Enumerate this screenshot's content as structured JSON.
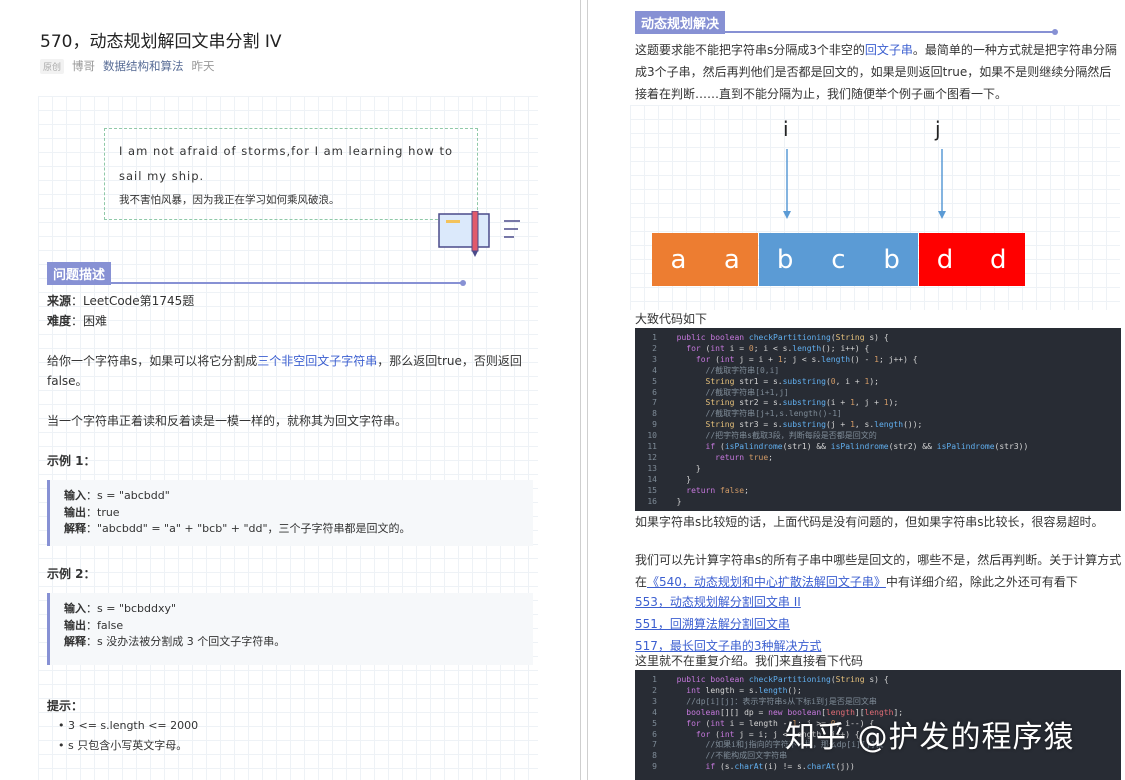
{
  "article": {
    "title": "570，动态规划解回文串分割 IV",
    "badge": "原创",
    "author": "博哥",
    "column": "数据结构和算法",
    "date": "昨天"
  },
  "quote": {
    "en": "I am not afraid of storms,for I am learning how to sail my ship.",
    "cn": "我不害怕风暴，因为我正在学习如何乘风破浪。"
  },
  "problem": {
    "section_title": "问题描述",
    "source_label": "来源",
    "source_value": "：LeetCode第1745题",
    "difficulty_label": "难度",
    "difficulty_value": "：困难",
    "desc_a": "给你一个字符串s，如果可以将它分割成",
    "desc_hl": "三个非空回文子字符串",
    "desc_b": "，那么返回true，否则返回false。",
    "desc2": "当一个字符串正着读和反着读是一模一样的，就称其为回文字符串。",
    "example1_title": "示例 1：",
    "example1": {
      "input_label": "输入",
      "input": "：s = \"abcbdd\"",
      "output_label": "输出",
      "output": "：true",
      "explain_label": "解释",
      "explain": "：\"abcbdd\" = \"a\" + \"bcb\" + \"dd\"，三个子字符串都是回文的。"
    },
    "example2_title": "示例 2：",
    "example2": {
      "input_label": "输入",
      "input": "：s = \"bcbddxy\"",
      "output_label": "输出",
      "output": "：false",
      "explain_label": "解释",
      "explain": "：s 没办法被分割成 3 个回文子字符串。"
    },
    "hint_title": "提示：",
    "hints": [
      "3 <= s.length <= 2000",
      "s 只包含小写英文字母。"
    ]
  },
  "solution": {
    "section_title": "动态规划解决",
    "p1_a": "这题要求能不能把字符串s分隔成3个非空的",
    "p1_hl": "回文子串",
    "p1_b": "。最简单的一种方式就是把字符串分隔成3个子串，然后再判他们是否都是回文的，如果是则返回true，如果不是则继续分隔然后接着在判断……直到不能分隔为止，我们随便举个例子画个图看一下。",
    "diagram": {
      "pointer_i": "i",
      "pointer_j": "j",
      "cells": [
        {
          "ch": "a",
          "color": "#ed7d31"
        },
        {
          "ch": "a",
          "color": "#ed7d31"
        },
        {
          "ch": "b",
          "color": "#5b9bd5"
        },
        {
          "ch": "c",
          "color": "#5b9bd5"
        },
        {
          "ch": "b",
          "color": "#5b9bd5"
        },
        {
          "ch": "d",
          "color": "#ff0000"
        },
        {
          "ch": "d",
          "color": "#ff0000"
        }
      ]
    },
    "code_caption": "大致代码如下",
    "p2": "如果字符串s比较短的话，上面代码是没有问题的，但如果字符串s比较长，很容易超时。",
    "p3_a": "我们可以先计算字符串s的所有子串中哪些是回文的，哪些不是，然后再判断。关于计算方式在",
    "p3_link": "《540，动态规划和中心扩散法解回文子串》",
    "p3_b": "中有详细介绍，除此之外还可有看下",
    "links": [
      "553，动态规划解分割回文串 II",
      "551，回溯算法解分割回文串",
      "517，最长回文子串的3种解决方式"
    ],
    "p4": "这里就不在重复介绍。我们来直接看下代码",
    "watermark": "知乎 @护发的程序猿"
  }
}
